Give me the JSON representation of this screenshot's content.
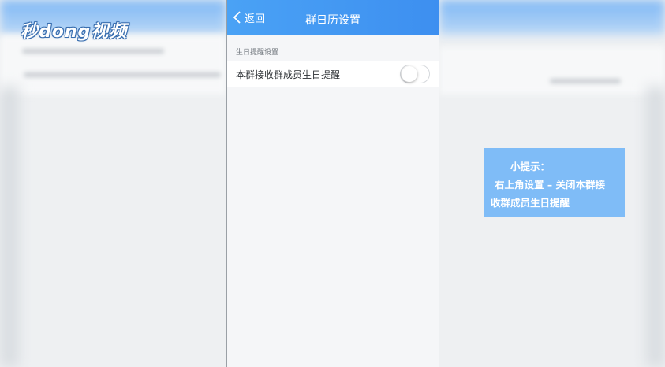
{
  "watermark": {
    "text": "秒dong视频"
  },
  "navbar": {
    "back_label": "返回",
    "title": "群日历设置"
  },
  "section": {
    "header": "生日提醒设置"
  },
  "setting_row": {
    "label": "本群接收群成员生日提醒",
    "toggle_on": false
  },
  "tip": {
    "line1": "小提示：",
    "line2": "右上角设置 – 关闭本群接",
    "line3": "收群成员生日提醒"
  },
  "colors": {
    "navbar": "#4aa2f5",
    "tip_bg": "#7fbcf7",
    "page_bg": "#f5f6f8"
  }
}
